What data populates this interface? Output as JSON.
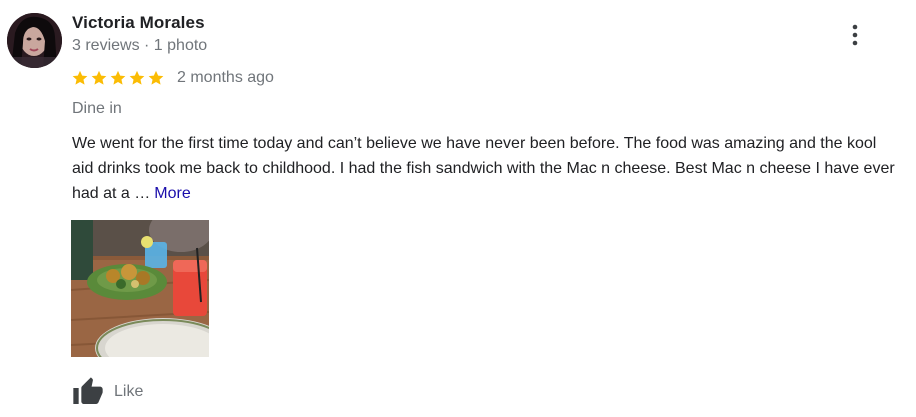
{
  "review": {
    "author": "Victoria Morales",
    "author_meta": "3 reviews · 1 photo",
    "rating": 5,
    "rating_max": 5,
    "time_ago": "2 months ago",
    "service_type": "Dine in",
    "text": "We went for the first time today and can’t believe we have never been before. The food was amazing and the kool aid drinks took me back to childhood. I had the fish sandwich with the Mac n cheese. Best Mac n cheese I have ever had at a …",
    "more_label": "More",
    "like_label": "Like"
  },
  "icons": {
    "star": "star-icon",
    "more": "more-vert-icon",
    "like": "thumb-up-icon"
  },
  "colors": {
    "star": "#fbbc04",
    "link": "#1a0dab",
    "secondary_text": "#70757a",
    "primary_text": "#202124",
    "icon_dark": "#3c4043"
  }
}
